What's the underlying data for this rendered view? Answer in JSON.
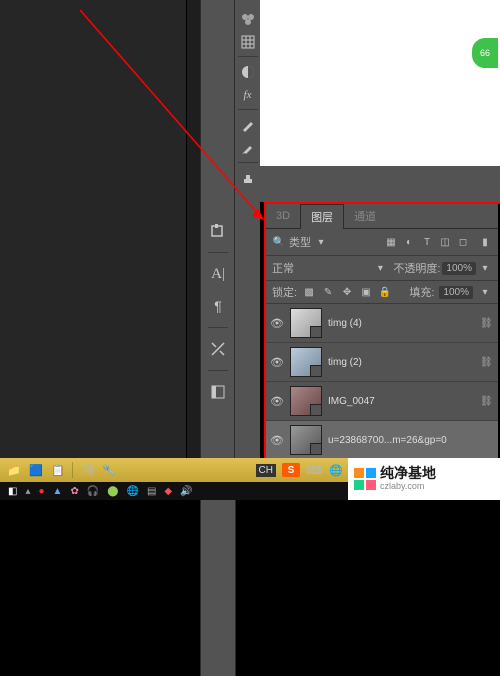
{
  "badge": "66",
  "panel": {
    "tabs": [
      "3D",
      "图层",
      "通道"
    ],
    "active_tab": 1,
    "filter_label": "类型",
    "blend_mode": "正常",
    "opacity_label": "不透明度:",
    "opacity_value": "100%",
    "lock_label": "锁定:",
    "fill_label": "填充:",
    "fill_value": "100%"
  },
  "layers": [
    {
      "name": "timg (4)",
      "selected": false
    },
    {
      "name": "timg (2)",
      "selected": false
    },
    {
      "name": "IMG_0047",
      "selected": false
    },
    {
      "name": "u=23868700...m=26&gp=0",
      "selected": true
    }
  ],
  "taskbar": {
    "ime": "CH"
  },
  "watermark": {
    "cn": "纯净基地",
    "url": "czlaby.com"
  }
}
